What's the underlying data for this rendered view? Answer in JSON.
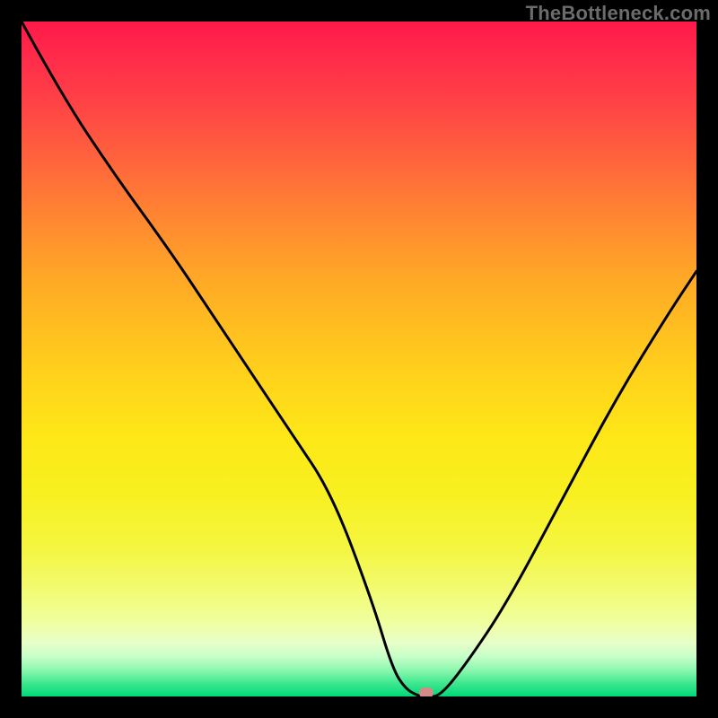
{
  "watermark": "TheBottleneck.com",
  "chart_data": {
    "type": "line",
    "title": "",
    "xlabel": "",
    "ylabel": "",
    "x_range": [
      0,
      100
    ],
    "y_range": [
      0,
      100
    ],
    "series": [
      {
        "name": "bottleneck-curve",
        "x": [
          0,
          6,
          14,
          22,
          28,
          34,
          40,
          46,
          52,
          55,
          57,
          59,
          60,
          62,
          66,
          72,
          80,
          88,
          96,
          100
        ],
        "y": [
          100,
          89,
          77,
          66,
          57,
          48,
          39,
          30,
          14,
          4,
          1,
          0,
          0,
          0,
          5,
          14,
          29,
          44,
          57,
          63
        ]
      }
    ],
    "marker": {
      "x": 60,
      "y": 0,
      "name": "optimal-point"
    },
    "gradient_stops": [
      {
        "pos": 0,
        "color": "#ff1a4a"
      },
      {
        "pos": 50,
        "color": "#ffd61a"
      },
      {
        "pos": 90,
        "color": "#f0ffa0"
      },
      {
        "pos": 100,
        "color": "#00d878"
      }
    ]
  }
}
